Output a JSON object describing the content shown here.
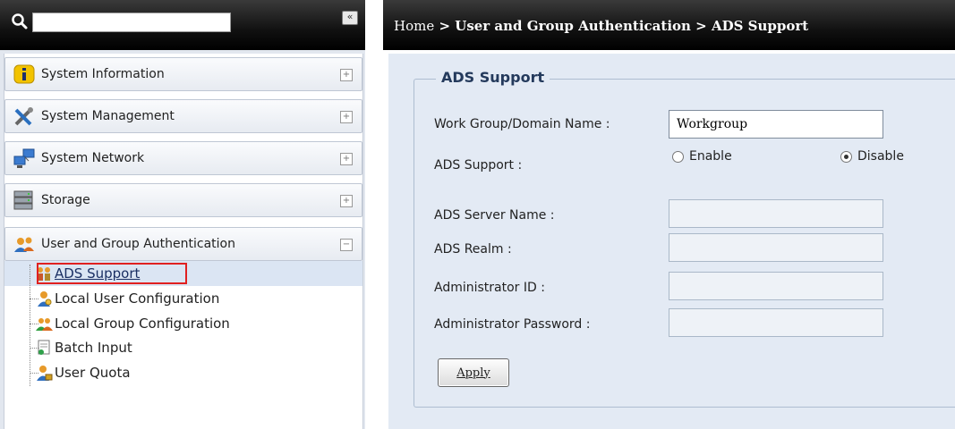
{
  "search": {
    "value": "",
    "placeholder": ""
  },
  "sidebar": {
    "collapse_label": "«",
    "categories": [
      {
        "label": "System Information",
        "toggle": "+",
        "icon": "info-icon"
      },
      {
        "label": "System Management",
        "toggle": "+",
        "icon": "tools-icon"
      },
      {
        "label": "System Network",
        "toggle": "+",
        "icon": "network-icon"
      },
      {
        "label": "Storage",
        "toggle": "+",
        "icon": "storage-icon"
      },
      {
        "label": "User and Group Authentication",
        "toggle": "−",
        "icon": "users-icon"
      }
    ],
    "subitems": [
      {
        "label": "ADS Support",
        "icon": "ads-icon",
        "active": true
      },
      {
        "label": "Local User Configuration",
        "icon": "local-user-icon"
      },
      {
        "label": "Local Group Configuration",
        "icon": "local-group-icon"
      },
      {
        "label": "Batch Input",
        "icon": "batch-input-icon"
      },
      {
        "label": "User Quota",
        "icon": "user-quota-icon"
      }
    ]
  },
  "header": {
    "breadcrumb_home": "Home",
    "breadcrumb_rest": " > User and Group Authentication > ADS Support"
  },
  "form": {
    "title": "ADS Support",
    "workgroup_label": "Work Group/Domain Name :",
    "workgroup_value": "Workgroup",
    "ads_support_label": "ADS Support :",
    "enable_label": "Enable",
    "disable_label": "Disable",
    "ads_support_selected": "Disable",
    "server_name_label": "ADS Server Name :",
    "server_name_value": "",
    "realm_label": "ADS Realm :",
    "realm_value": "",
    "admin_id_label": "Administrator ID :",
    "admin_id_value": "",
    "admin_password_label": "Administrator Password :",
    "admin_password_value": "",
    "apply_label": "Apply"
  },
  "colors": {
    "header_bg": "#000000",
    "content_bg": "#e3eaf4",
    "highlight_border": "#e02020",
    "active_row": "#dbe5f3"
  }
}
